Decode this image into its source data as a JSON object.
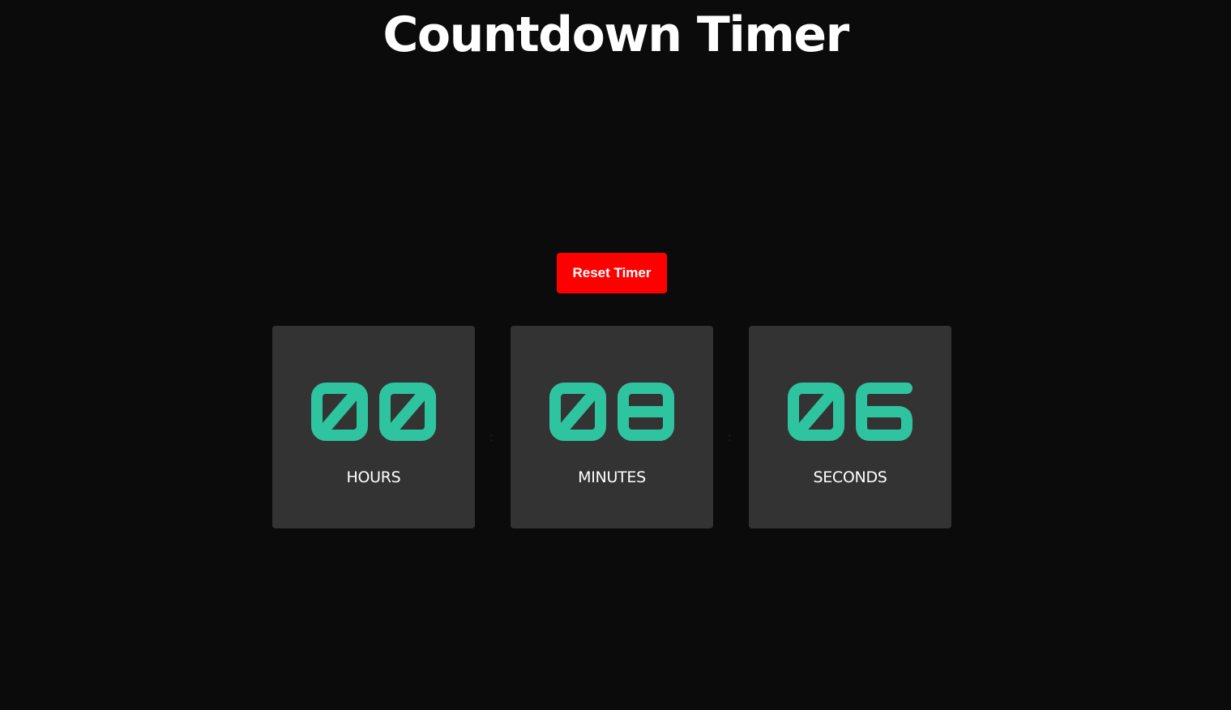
{
  "page": {
    "title": "Countdown Timer"
  },
  "controls": {
    "reset_label": "Reset Timer"
  },
  "timer": {
    "separator": ":",
    "digit_color": "#2ec4a0",
    "units": [
      {
        "key": "hours",
        "value": "00",
        "label": "HOURS"
      },
      {
        "key": "minutes",
        "value": "08",
        "label": "MINUTES"
      },
      {
        "key": "seconds",
        "value": "06",
        "label": "SECONDS"
      }
    ]
  },
  "colors": {
    "background": "#0b0b0b",
    "card": "#333333",
    "button": "#ff0000",
    "accent": "#2ec4a0"
  }
}
